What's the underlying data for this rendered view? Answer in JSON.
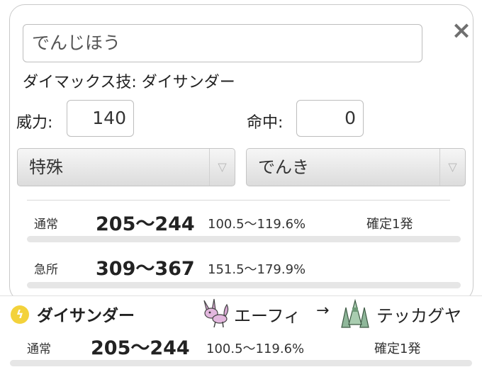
{
  "move_input": {
    "value": "でんじほう"
  },
  "dmax": {
    "label": "ダイマックス技:",
    "move": "ダイサンダー"
  },
  "power": {
    "label": "威力:",
    "value": "140"
  },
  "accuracy": {
    "label": "命中:",
    "value": "0"
  },
  "category_select": {
    "selected": "特殊"
  },
  "type_select": {
    "selected": "でんき"
  },
  "results": [
    {
      "label": "通常",
      "range": "205〜244",
      "percent": "100.5〜119.6%",
      "ko": "確定1発"
    },
    {
      "label": "急所",
      "range": "309〜367",
      "percent": "151.5〜179.9%",
      "ko": ""
    }
  ],
  "summary": {
    "move": "ダイサンダー",
    "attacker": "エーフィ",
    "arrow": "→",
    "defender": "テッカグヤ",
    "label": "通常",
    "range": "205〜244",
    "percent": "100.5〜119.6%",
    "ko": "確定1発"
  },
  "icons": {
    "close": "×",
    "dropdown": "▽",
    "bolt": "ϟ"
  },
  "colors": {
    "electric": "#f3d23b",
    "border": "#c9c9c9"
  }
}
